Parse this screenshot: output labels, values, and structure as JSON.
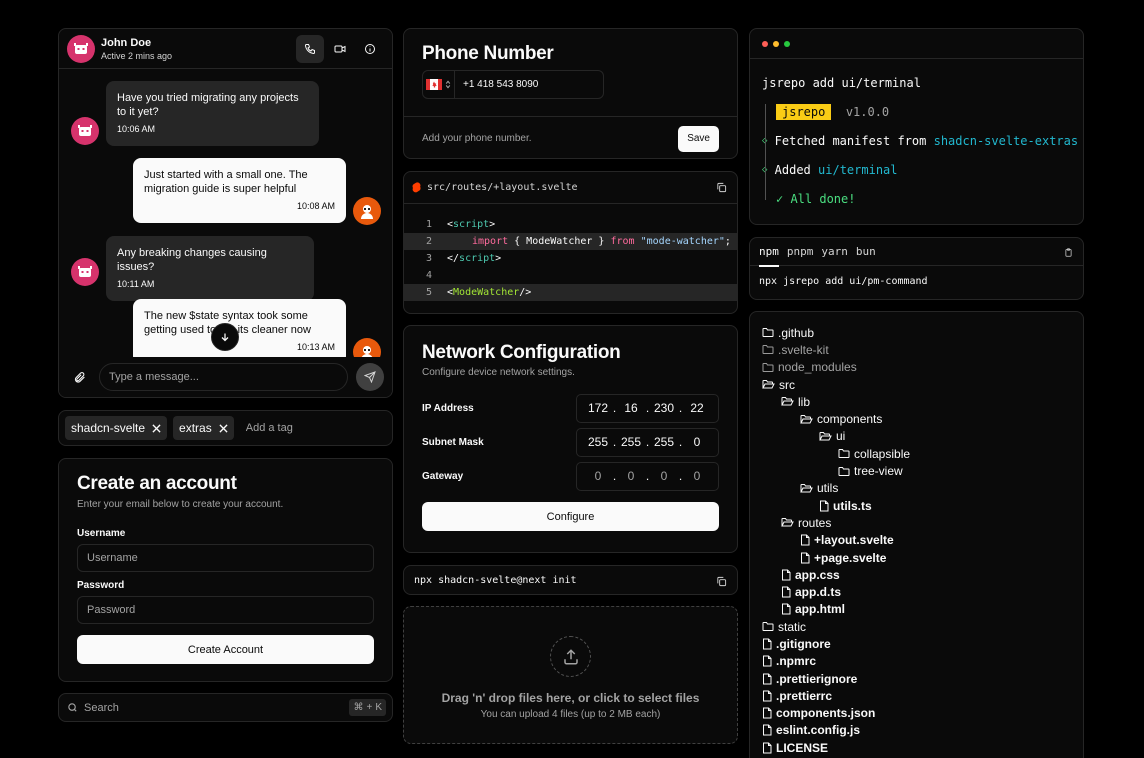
{
  "chat": {
    "user_name": "John Doe",
    "user_status": "Active 2 mins ago",
    "messages": [
      {
        "text": "Have you tried migrating any projects to it yet?",
        "time": "10:06 AM"
      },
      {
        "text": "Just started with a small one. The migration guide is super helpful",
        "time": "10:08 AM"
      },
      {
        "text": "Any breaking changes causing issues?",
        "time": "10:11 AM"
      },
      {
        "text": "The new $state syntax took some getting used to but its cleaner now",
        "time": "10:13 AM"
      }
    ],
    "input_placeholder": "Type a message..."
  },
  "tags": {
    "items": [
      "shadcn-svelte",
      "extras"
    ],
    "placeholder": "Add a tag"
  },
  "account": {
    "title": "Create an account",
    "subtitle": "Enter your email below to create your account.",
    "username_label": "Username",
    "username_placeholder": "Username",
    "password_label": "Password",
    "password_placeholder": "Password",
    "submit_label": "Create Account"
  },
  "search": {
    "placeholder": "Search",
    "shortcut_cmd": "⌘",
    "shortcut_plus": "+",
    "shortcut_key": "K"
  },
  "phone": {
    "title": "Phone Number",
    "value": "+1 418 543 8090",
    "hint": "Add your phone number.",
    "save_label": "Save"
  },
  "code": {
    "filename": "src/routes/+layout.svelte",
    "line_numbers": [
      "1",
      "2",
      "3",
      "4",
      "5"
    ],
    "l1_open": "<",
    "l1_tag": "script",
    "l1_close": ">",
    "l2_import": "import",
    "l2_mid": " { ModeWatcher } ",
    "l2_from": "from",
    "l2_str": "\"mode-watcher\"",
    "l2_end": ";",
    "l3_open": "</",
    "l3_tag": "script",
    "l3_close": ">",
    "l5_open": "<",
    "l5_comp": "ModeWatcher",
    "l5_close": "/>"
  },
  "network": {
    "title": "Network Configuration",
    "subtitle": "Configure device network settings.",
    "rows": [
      {
        "label": "IP Address",
        "octets": [
          "172",
          "16",
          "230",
          "22"
        ]
      },
      {
        "label": "Subnet Mask",
        "octets": [
          "255",
          "255",
          "255",
          "0"
        ]
      },
      {
        "label": "Gateway",
        "octets": [
          "0",
          "0",
          "0",
          "0"
        ]
      }
    ],
    "submit_label": "Configure"
  },
  "install_cmd": "npx shadcn-svelte@next init",
  "dropzone": {
    "title": "Drag 'n' drop files here, or click to select files",
    "subtitle": "You can upload 4 files (up to 2 MB each)"
  },
  "terminal": {
    "command": "jsrepo add ui/terminal",
    "badge": "jsrepo",
    "version": "v1.0.0",
    "fetched": "Fetched manifest from ",
    "fetched_source": "shadcn-svelte-extras",
    "added": "Added ",
    "added_item": "ui/terminal",
    "done": "✓ All done!",
    "colors": {
      "red": "#ff5f56",
      "yellow": "#ffbd2e",
      "green": "#27c93f"
    }
  },
  "pm": {
    "tabs": [
      "npm",
      "pnpm",
      "yarn",
      "bun"
    ],
    "active_tab": "npm",
    "command": "npx jsrepo add ui/pm-command"
  },
  "tree": [
    {
      "name": ".github",
      "type": "folder",
      "depth": 0,
      "dim": false
    },
    {
      "name": ".svelte-kit",
      "type": "folder",
      "depth": 0,
      "dim": true
    },
    {
      "name": "node_modules",
      "type": "folder",
      "depth": 0,
      "dim": true
    },
    {
      "name": "src",
      "type": "folder-open",
      "depth": 0,
      "dim": false
    },
    {
      "name": "lib",
      "type": "folder-open",
      "depth": 1,
      "dim": false
    },
    {
      "name": "components",
      "type": "folder-open",
      "depth": 2,
      "dim": false
    },
    {
      "name": "ui",
      "type": "folder-open",
      "depth": 3,
      "dim": false
    },
    {
      "name": "collapsible",
      "type": "folder",
      "depth": 4,
      "dim": false
    },
    {
      "name": "tree-view",
      "type": "folder",
      "depth": 4,
      "dim": false
    },
    {
      "name": "utils",
      "type": "folder-open",
      "depth": 2,
      "dim": false
    },
    {
      "name": "utils.ts",
      "type": "file",
      "depth": 3,
      "dim": false
    },
    {
      "name": "routes",
      "type": "folder-open",
      "depth": 1,
      "dim": false
    },
    {
      "name": "+layout.svelte",
      "type": "file",
      "depth": 2,
      "dim": false
    },
    {
      "name": "+page.svelte",
      "type": "file",
      "depth": 2,
      "dim": false
    },
    {
      "name": "app.css",
      "type": "file",
      "depth": 1,
      "dim": false
    },
    {
      "name": "app.d.ts",
      "type": "file",
      "depth": 1,
      "dim": false
    },
    {
      "name": "app.html",
      "type": "file",
      "depth": 1,
      "dim": false
    },
    {
      "name": "static",
      "type": "folder",
      "depth": 0,
      "dim": false
    },
    {
      "name": ".gitignore",
      "type": "file",
      "depth": 0,
      "dim": false
    },
    {
      "name": ".npmrc",
      "type": "file",
      "depth": 0,
      "dim": false
    },
    {
      "name": ".prettierignore",
      "type": "file",
      "depth": 0,
      "dim": false
    },
    {
      "name": ".prettierrc",
      "type": "file",
      "depth": 0,
      "dim": false
    },
    {
      "name": "components.json",
      "type": "file",
      "depth": 0,
      "dim": false
    },
    {
      "name": "eslint.config.js",
      "type": "file",
      "depth": 0,
      "dim": false
    },
    {
      "name": "LICENSE",
      "type": "file",
      "depth": 0,
      "dim": false
    }
  ]
}
